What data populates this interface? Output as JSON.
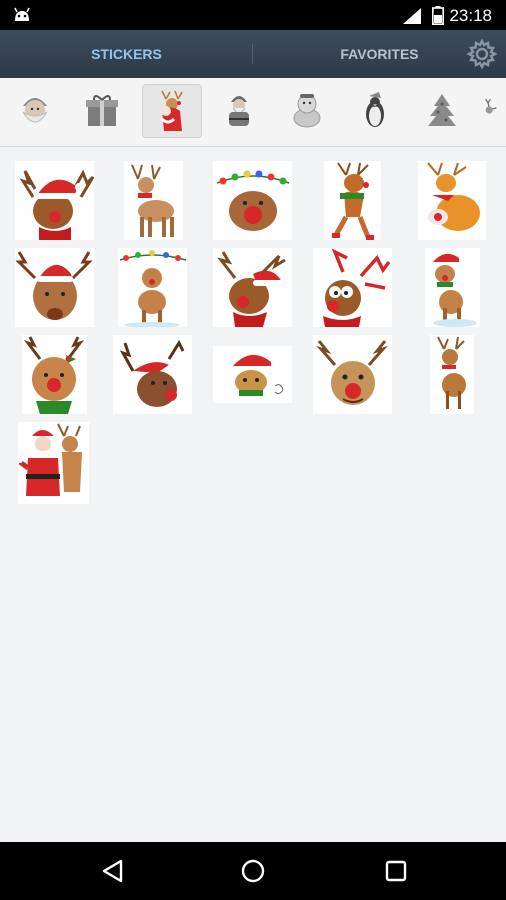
{
  "status_bar": {
    "time": "23:18"
  },
  "tabs": [
    {
      "label": "STICKERS",
      "selected": true
    },
    {
      "label": "FAVORITES",
      "selected": false
    }
  ],
  "categories": [
    "santa-face-icon",
    "gift-box-icon",
    "santa-deer-icon",
    "santa-icon",
    "snowman-icon",
    "penguin-icon",
    "christmas-tree-icon",
    "reindeer-partial-icon"
  ],
  "selected_category": 2,
  "stickers": [
    "reindeer-santa-hat-sticker",
    "reindeer-standing-sticker",
    "reindeer-lights-sticker",
    "reindeer-running-sticker",
    "reindeer-sitting-sticker",
    "reindeer-hat-face-sticker",
    "reindeer-lights-standing-sticker",
    "reindeer-hat-scarf-sticker",
    "reindeer-wink-sticker",
    "reindeer-hat-snow-sticker",
    "reindeer-holly-sticker",
    "reindeer-tilt-sticker",
    "reindeer-baby-hat-sticker",
    "reindeer-smile-sticker",
    "reindeer-small-sticker",
    "santa-reindeer-hug-sticker"
  ],
  "colors": {
    "appbar": "#2c3947",
    "tab_selected": "#8fc5f0",
    "tab_normal": "#b9c1c9",
    "background": "#f2f3f4"
  }
}
